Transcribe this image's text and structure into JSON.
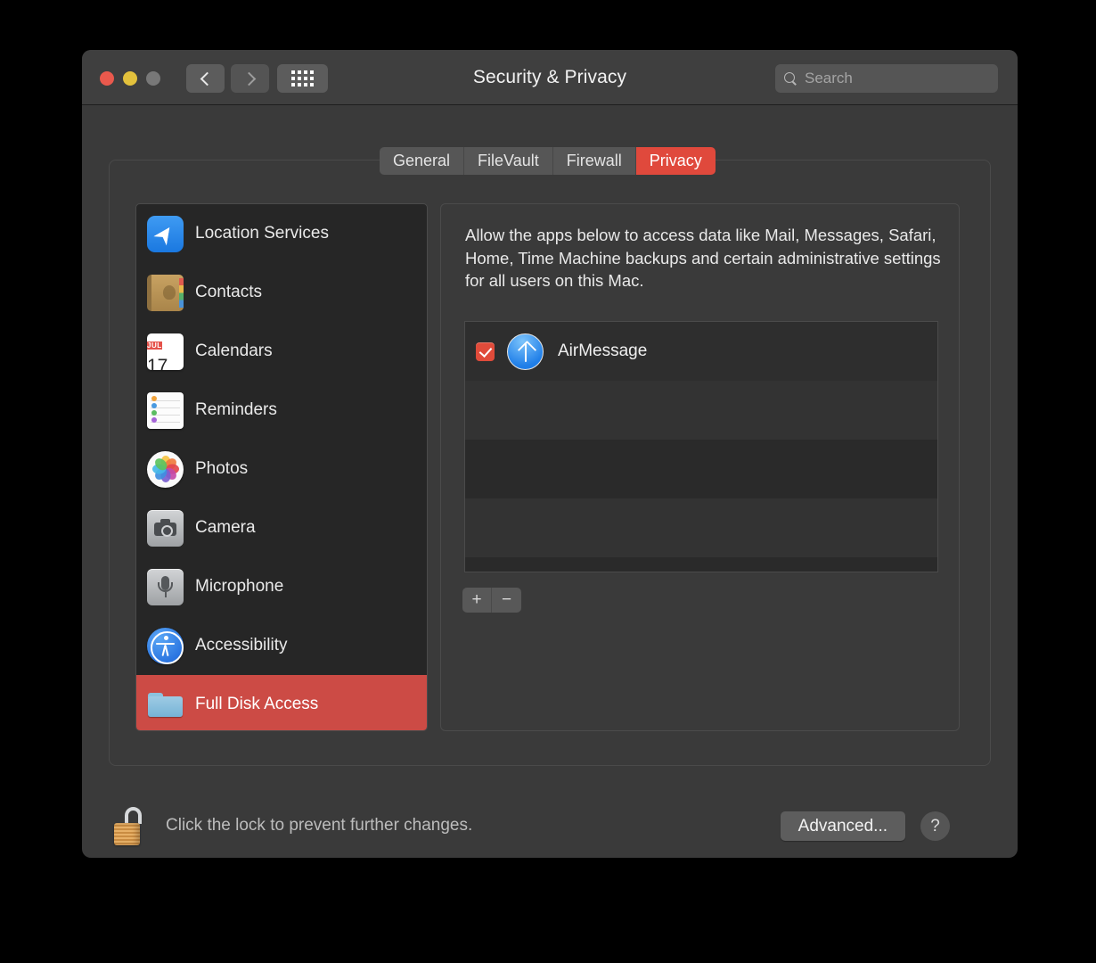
{
  "window": {
    "title": "Security & Privacy",
    "traffic_lights": [
      "close",
      "minimize",
      "zoom"
    ],
    "nav": {
      "back": "back-arrow",
      "forward": "forward-arrow",
      "show_all": "grid-icon"
    },
    "search": {
      "placeholder": "Search",
      "value": "",
      "icon": "search-icon"
    }
  },
  "tabs": [
    {
      "label": "General",
      "active": false
    },
    {
      "label": "FileVault",
      "active": false
    },
    {
      "label": "Firewall",
      "active": false
    },
    {
      "label": "Privacy",
      "active": true
    }
  ],
  "sidebar": {
    "items": [
      {
        "label": "Location Services",
        "icon": "location-services-icon",
        "selected": false
      },
      {
        "label": "Contacts",
        "icon": "contacts-icon",
        "selected": false
      },
      {
        "label": "Calendars",
        "icon": "calendars-icon",
        "selected": false
      },
      {
        "label": "Reminders",
        "icon": "reminders-icon",
        "selected": false
      },
      {
        "label": "Photos",
        "icon": "photos-icon",
        "selected": false
      },
      {
        "label": "Camera",
        "icon": "camera-icon",
        "selected": false
      },
      {
        "label": "Microphone",
        "icon": "microphone-icon",
        "selected": false
      },
      {
        "label": "Accessibility",
        "icon": "accessibility-icon",
        "selected": false
      },
      {
        "label": "Full Disk Access",
        "icon": "folder-icon",
        "selected": true
      }
    ],
    "calendar_icon": {
      "month": "JUL",
      "day": "17"
    }
  },
  "main": {
    "description": "Allow the apps below to access data like Mail, Messages, Safari, Home, Time Machine backups and certain administrative settings for all users on this Mac.",
    "apps": [
      {
        "name": "AirMessage",
        "checked": true,
        "icon": "airmessage-icon"
      }
    ],
    "list_controls": {
      "add": "+",
      "remove": "−"
    }
  },
  "bottom": {
    "lock_icon": "unlocked-padlock-icon",
    "lock_text": "Click the lock to prevent further changes.",
    "advanced_label": "Advanced...",
    "help_label": "?"
  },
  "colors": {
    "accent_red": "#e0493c",
    "selection_red": "#cc4b45",
    "checkbox_red": "#e04b3a",
    "window_bg": "#3a3a3a",
    "titlebar_bg": "#3f3f3f",
    "sidebar_bg": "#262626"
  }
}
